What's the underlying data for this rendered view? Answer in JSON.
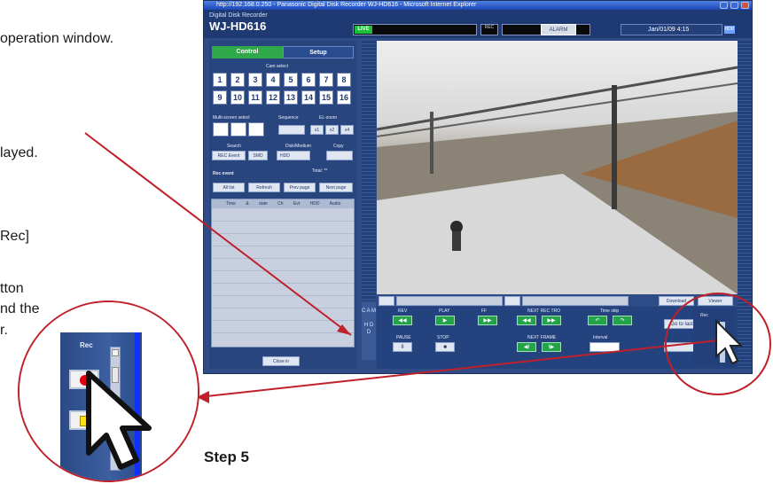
{
  "instructions": {
    "line1": "operation window.",
    "line2": "layed.",
    "line3": "Rec]",
    "line4": "tton",
    "line5": "nd the",
    "line6": "r.",
    "step": "Step 5"
  },
  "browser": {
    "title": "http://192.168.0.250 - Panasonic Digital Disk Recorder WJ-HD616 - Microsoft Internet Explorer"
  },
  "app": {
    "product_line": "Digital Disk Recorder",
    "model": "WJ-HD616",
    "live_label": "LIVE",
    "rec_label": "REC",
    "alarm_label": "ALARM",
    "datetime": "Jan/01/09 4:15",
    "hdd_label": "HDD",
    "tabs": [
      "Control",
      "Setup"
    ],
    "cam_select_label": "Cam select",
    "cameras": [
      "1",
      "2",
      "3",
      "4",
      "5",
      "6",
      "7",
      "8",
      "9",
      "10",
      "11",
      "12",
      "13",
      "14",
      "15",
      "16"
    ],
    "multiscreen_label": "Multi-screen select",
    "sequence_label": "Sequence",
    "elzoom_label": "EL-zoom",
    "zoom_levels": [
      "x1",
      "x2",
      "x4"
    ],
    "search_label": "Search",
    "search_buttons": [
      "REC Event",
      "SMD"
    ],
    "disk_label": "Disk/Medium",
    "disk_value": "HDD",
    "copy_label": "Copy",
    "rec_event_label": "Rec event",
    "total_label": "Total: **",
    "list_buttons": [
      "All list",
      "Refresh",
      "Prev page",
      "Next page"
    ],
    "list_headers": [
      "Time & date",
      "Ch",
      "Evt",
      "HDD",
      "Audio"
    ],
    "close_button": "Close in",
    "cam_side_label": "C A M",
    "hdd_side_label": "H D D",
    "download_label": "Download",
    "viewer_label": "Viewer",
    "controls": {
      "rev": "REV",
      "play": "PLAY",
      "ff": "FF",
      "next_rec": "NEXT REC TRO",
      "time_skip": "Time skip",
      "pause": "PAUSE",
      "stop": "STOP",
      "next_frame": "NEXT FRAME",
      "interval": "Interval",
      "go_to": "Go to last"
    },
    "rec_panel_label": "Rec"
  },
  "zoom_inset": {
    "rec_label": "Rec"
  }
}
